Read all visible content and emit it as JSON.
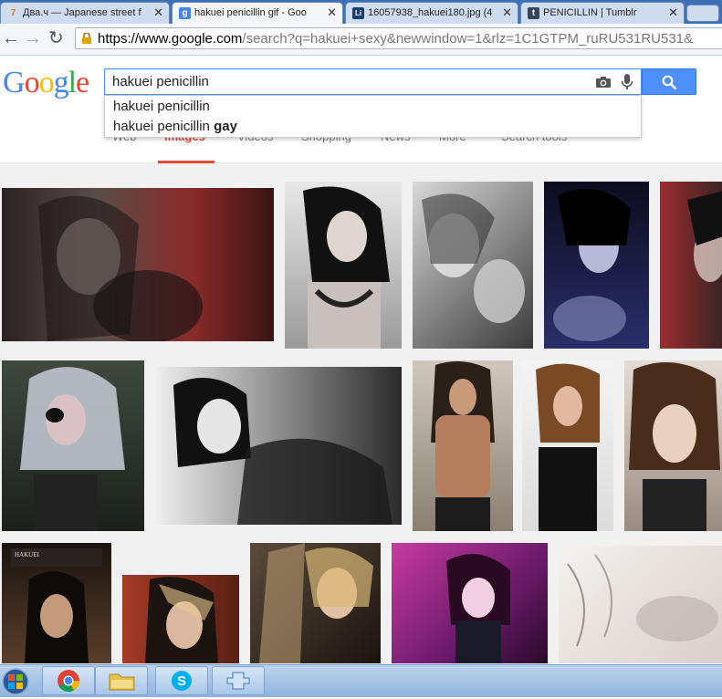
{
  "tabs": [
    {
      "favicon": "7",
      "favicon_color": "#e07b22",
      "title": "Два.ч — Japanese street f"
    },
    {
      "favicon": "g",
      "favicon_color": "#4285f4",
      "title": "hakuei penicillin gif - Goo"
    },
    {
      "favicon": "Li",
      "favicon_color": "#1a3d6d",
      "title": "16057938_hakuei180.jpg (4"
    },
    {
      "favicon": "t",
      "favicon_color": "#35465c",
      "title": "PENICILLIN | Tumblr"
    }
  ],
  "address_bar": {
    "url_host": "https://www.google.com",
    "url_rest": "/search?q=hakuei+sexy&newwindow=1&rlz=1C1GTPM_ruRU531RU531&"
  },
  "google": {
    "logo": [
      "G",
      "o",
      "o",
      "g",
      "l",
      "e"
    ],
    "logo_colors": [
      "#4285f4",
      "#ea4335",
      "#fbbc05",
      "#4285f4",
      "#34a853",
      "#ea4335"
    ],
    "query": "hakuei penicillin",
    "suggestions": [
      {
        "base": "hakuei penicillin",
        "bold": ""
      },
      {
        "base": "hakuei penicillin ",
        "bold": "gay"
      }
    ],
    "nav": {
      "web": "Web",
      "images": "Images",
      "videos": "Videos",
      "shopping": "Shopping",
      "news": "News",
      "more": "More",
      "search_tools": "Search tools"
    }
  },
  "colors": {
    "search_blue": "#4d90fe",
    "active_tab_red": "#dd4b39"
  }
}
